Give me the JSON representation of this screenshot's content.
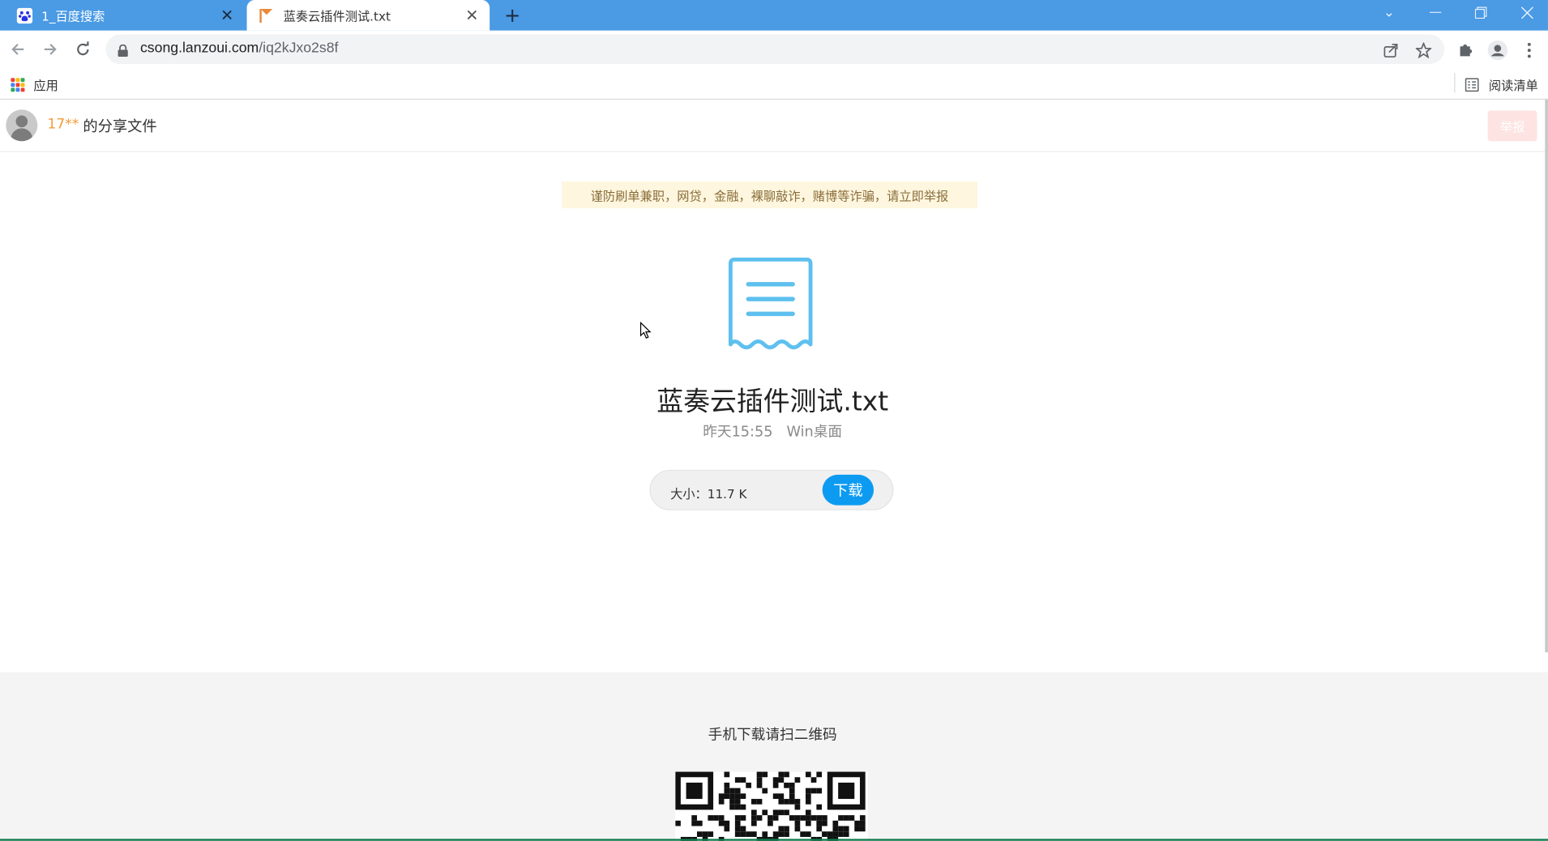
{
  "browser": {
    "tabs": [
      {
        "title": "1_百度搜索",
        "active": false,
        "favicon": "baidu-paw-icon"
      },
      {
        "title": "蓝奏云插件测试.txt",
        "active": true,
        "favicon": "lanzou-flag-icon"
      }
    ],
    "new_tab_label": "+",
    "url_host": "csong.lanzoui.com",
    "url_path": "/iq2kJxo2s8f",
    "bookmarks": {
      "apps_label": "应用",
      "reading_list_label": "阅读清单"
    },
    "accent_color": "#4a9ae4"
  },
  "page": {
    "uploader_name": "17**",
    "share_label": "的分享文件",
    "report_label": "举报",
    "warning_text": "谨防刷单兼职，网贷，金融，裸聊敲诈，赌博等诈骗，请立即举报",
    "file": {
      "name": "蓝奏云插件测试.txt",
      "time": "昨天15:55",
      "folder": "Win桌面",
      "size_text": "大小：11.7 K"
    },
    "download_label": "下载",
    "qr_label": "手机下载请扫二维码",
    "colors": {
      "download_button": "#0d9bf2",
      "uploader": "#f39c3a",
      "warning_bg": "#fef6de",
      "file_icon": "#5ec0ef"
    }
  }
}
